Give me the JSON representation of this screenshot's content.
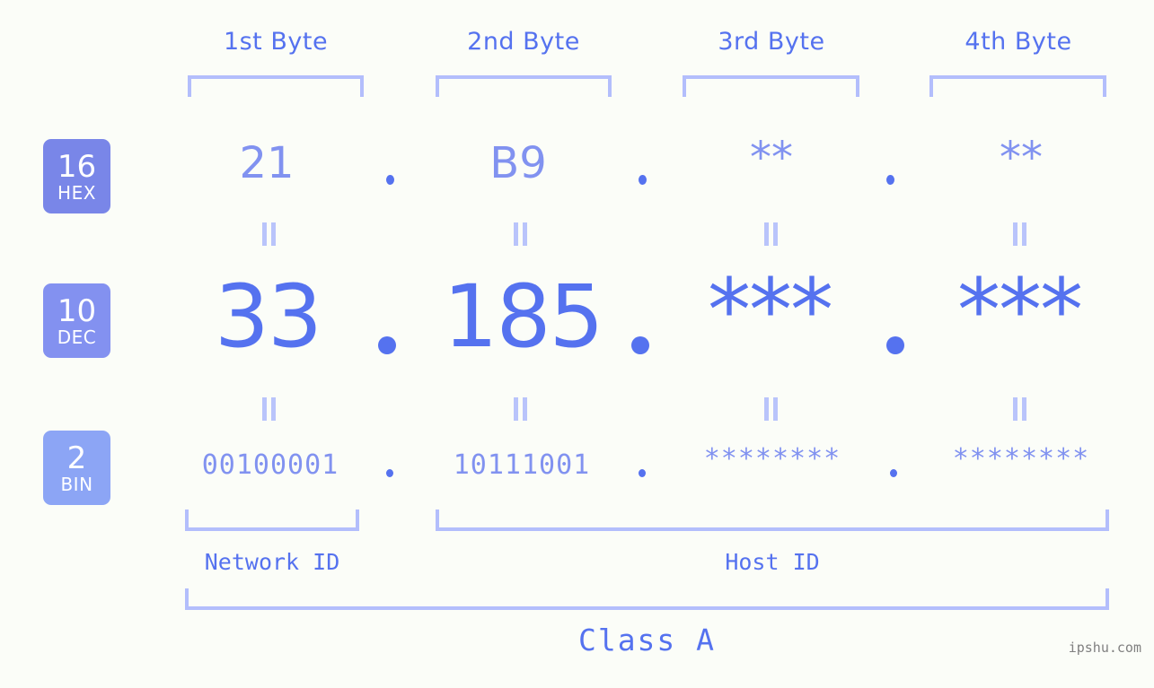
{
  "watermark": "ipshu.com",
  "columns": [
    {
      "header": "1st Byte"
    },
    {
      "header": "2nd Byte"
    },
    {
      "header": "3rd Byte"
    },
    {
      "header": "4th Byte"
    }
  ],
  "rows": [
    {
      "base": "16",
      "base_label": "HEX",
      "badge_color": "#7986e8",
      "values": [
        "21",
        "B9",
        "**",
        "**"
      ]
    },
    {
      "base": "10",
      "base_label": "DEC",
      "badge_color": "#8391f0",
      "values": [
        "33",
        "185",
        "***",
        "***"
      ]
    },
    {
      "base": "2",
      "base_label": "BIN",
      "badge_color": "#8ca5f5",
      "values": [
        "00100001",
        "10111001",
        "********",
        "********"
      ]
    }
  ],
  "separators": {
    "hex": [
      ".",
      ".",
      "."
    ],
    "dec": [
      ".",
      ".",
      "."
    ],
    "bin": [
      ".",
      ".",
      "."
    ]
  },
  "equals_symbol": "=",
  "zones": {
    "network_id": "Network ID",
    "host_id": "Host ID",
    "class": "Class A"
  },
  "colors": {
    "background": "#fbfdf8",
    "accent_strong": "#5572ef",
    "accent_mid": "#8192f0",
    "accent_light": "#b3befc",
    "watermark": "#808080"
  }
}
